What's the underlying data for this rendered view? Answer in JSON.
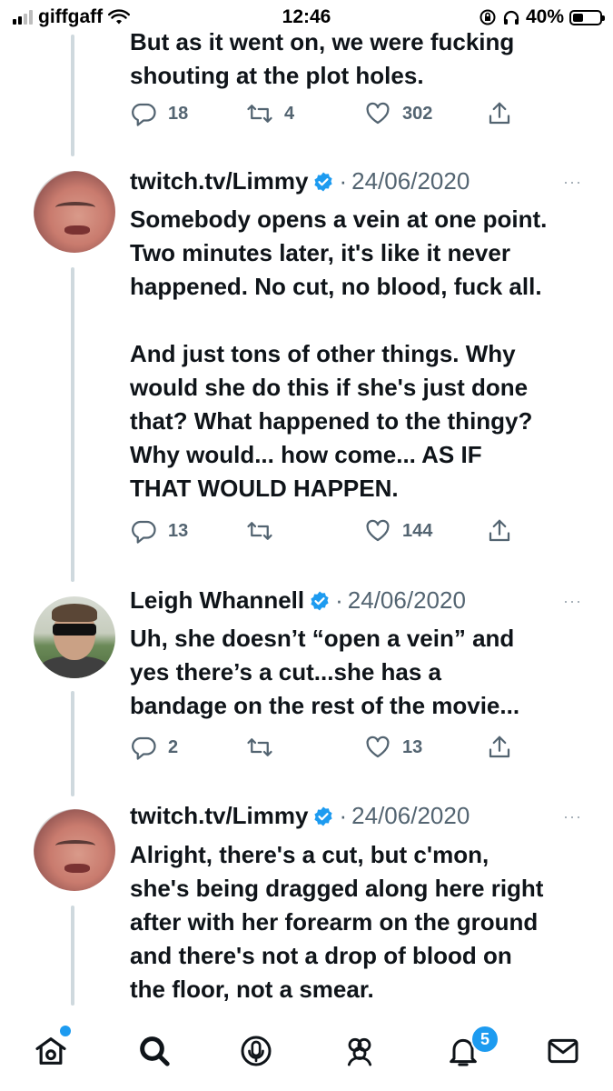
{
  "status_bar": {
    "carrier": "giffgaff",
    "time": "12:46",
    "battery": "40%",
    "battery_level": 0.4,
    "icons": [
      "signal-icon",
      "wifi-icon",
      "orientation-lock-icon",
      "headphones-icon",
      "battery-icon"
    ]
  },
  "top_tweet": {
    "text": "But as it went on, we were fucking\nshouting at the plot holes.",
    "replies": "18",
    "retweets": "4",
    "likes": "302"
  },
  "tweets": [
    {
      "name": "twitch.tv/Limmy",
      "date": "24/06/2020",
      "text": "Somebody opens a vein at one point.\nTwo minutes later, it's like it never\nhappened. No cut, no blood, fuck all.\n\nAnd just tons of other things. Why\nwould she do this if she's just done\nthat? What happened to the thingy?\nWhy would... how come... AS IF\nTHAT WOULD HAPPEN.",
      "replies": "13",
      "retweets": "",
      "likes": "144"
    },
    {
      "name": "Leigh Whannell",
      "date": "24/06/2020",
      "text": "Uh, she doesn’t “open a vein” and\nyes there’s a cut...she has a\nbandage on the rest of the movie...",
      "replies": "2",
      "retweets": "",
      "likes": "13"
    },
    {
      "name": "twitch.tv/Limmy",
      "date": "24/06/2020",
      "text": "Alright, there's a cut, but c'mon,\nshe's being dragged along here right\nafter with her forearm on the ground\nand there's not a drop of blood on\nthe floor, not a smear."
    }
  ],
  "separator": "·",
  "more_glyph": "···",
  "tab_bar": {
    "items": [
      "home-icon",
      "search-icon",
      "spaces-icon",
      "communities-icon",
      "notifications-icon",
      "messages-icon"
    ],
    "notification_count": "5"
  },
  "colors": {
    "accent": "#1d9bf0",
    "muted": "#536471",
    "text": "#0f1419",
    "thread_line": "#cfd9de"
  }
}
